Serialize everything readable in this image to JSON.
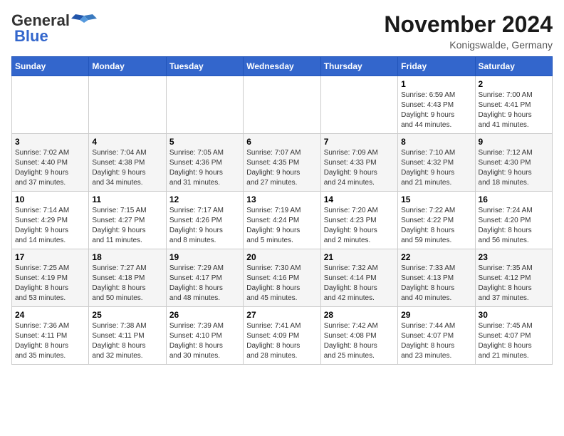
{
  "header": {
    "logo_general": "General",
    "logo_blue": "Blue",
    "month_title": "November 2024",
    "location": "Konigswalde, Germany"
  },
  "weekdays": [
    "Sunday",
    "Monday",
    "Tuesday",
    "Wednesday",
    "Thursday",
    "Friday",
    "Saturday"
  ],
  "weeks": [
    [
      {
        "day": "",
        "info": ""
      },
      {
        "day": "",
        "info": ""
      },
      {
        "day": "",
        "info": ""
      },
      {
        "day": "",
        "info": ""
      },
      {
        "day": "",
        "info": ""
      },
      {
        "day": "1",
        "info": "Sunrise: 6:59 AM\nSunset: 4:43 PM\nDaylight: 9 hours\nand 44 minutes."
      },
      {
        "day": "2",
        "info": "Sunrise: 7:00 AM\nSunset: 4:41 PM\nDaylight: 9 hours\nand 41 minutes."
      }
    ],
    [
      {
        "day": "3",
        "info": "Sunrise: 7:02 AM\nSunset: 4:40 PM\nDaylight: 9 hours\nand 37 minutes."
      },
      {
        "day": "4",
        "info": "Sunrise: 7:04 AM\nSunset: 4:38 PM\nDaylight: 9 hours\nand 34 minutes."
      },
      {
        "day": "5",
        "info": "Sunrise: 7:05 AM\nSunset: 4:36 PM\nDaylight: 9 hours\nand 31 minutes."
      },
      {
        "day": "6",
        "info": "Sunrise: 7:07 AM\nSunset: 4:35 PM\nDaylight: 9 hours\nand 27 minutes."
      },
      {
        "day": "7",
        "info": "Sunrise: 7:09 AM\nSunset: 4:33 PM\nDaylight: 9 hours\nand 24 minutes."
      },
      {
        "day": "8",
        "info": "Sunrise: 7:10 AM\nSunset: 4:32 PM\nDaylight: 9 hours\nand 21 minutes."
      },
      {
        "day": "9",
        "info": "Sunrise: 7:12 AM\nSunset: 4:30 PM\nDaylight: 9 hours\nand 18 minutes."
      }
    ],
    [
      {
        "day": "10",
        "info": "Sunrise: 7:14 AM\nSunset: 4:29 PM\nDaylight: 9 hours\nand 14 minutes."
      },
      {
        "day": "11",
        "info": "Sunrise: 7:15 AM\nSunset: 4:27 PM\nDaylight: 9 hours\nand 11 minutes."
      },
      {
        "day": "12",
        "info": "Sunrise: 7:17 AM\nSunset: 4:26 PM\nDaylight: 9 hours\nand 8 minutes."
      },
      {
        "day": "13",
        "info": "Sunrise: 7:19 AM\nSunset: 4:24 PM\nDaylight: 9 hours\nand 5 minutes."
      },
      {
        "day": "14",
        "info": "Sunrise: 7:20 AM\nSunset: 4:23 PM\nDaylight: 9 hours\nand 2 minutes."
      },
      {
        "day": "15",
        "info": "Sunrise: 7:22 AM\nSunset: 4:22 PM\nDaylight: 8 hours\nand 59 minutes."
      },
      {
        "day": "16",
        "info": "Sunrise: 7:24 AM\nSunset: 4:20 PM\nDaylight: 8 hours\nand 56 minutes."
      }
    ],
    [
      {
        "day": "17",
        "info": "Sunrise: 7:25 AM\nSunset: 4:19 PM\nDaylight: 8 hours\nand 53 minutes."
      },
      {
        "day": "18",
        "info": "Sunrise: 7:27 AM\nSunset: 4:18 PM\nDaylight: 8 hours\nand 50 minutes."
      },
      {
        "day": "19",
        "info": "Sunrise: 7:29 AM\nSunset: 4:17 PM\nDaylight: 8 hours\nand 48 minutes."
      },
      {
        "day": "20",
        "info": "Sunrise: 7:30 AM\nSunset: 4:16 PM\nDaylight: 8 hours\nand 45 minutes."
      },
      {
        "day": "21",
        "info": "Sunrise: 7:32 AM\nSunset: 4:14 PM\nDaylight: 8 hours\nand 42 minutes."
      },
      {
        "day": "22",
        "info": "Sunrise: 7:33 AM\nSunset: 4:13 PM\nDaylight: 8 hours\nand 40 minutes."
      },
      {
        "day": "23",
        "info": "Sunrise: 7:35 AM\nSunset: 4:12 PM\nDaylight: 8 hours\nand 37 minutes."
      }
    ],
    [
      {
        "day": "24",
        "info": "Sunrise: 7:36 AM\nSunset: 4:11 PM\nDaylight: 8 hours\nand 35 minutes."
      },
      {
        "day": "25",
        "info": "Sunrise: 7:38 AM\nSunset: 4:11 PM\nDaylight: 8 hours\nand 32 minutes."
      },
      {
        "day": "26",
        "info": "Sunrise: 7:39 AM\nSunset: 4:10 PM\nDaylight: 8 hours\nand 30 minutes."
      },
      {
        "day": "27",
        "info": "Sunrise: 7:41 AM\nSunset: 4:09 PM\nDaylight: 8 hours\nand 28 minutes."
      },
      {
        "day": "28",
        "info": "Sunrise: 7:42 AM\nSunset: 4:08 PM\nDaylight: 8 hours\nand 25 minutes."
      },
      {
        "day": "29",
        "info": "Sunrise: 7:44 AM\nSunset: 4:07 PM\nDaylight: 8 hours\nand 23 minutes."
      },
      {
        "day": "30",
        "info": "Sunrise: 7:45 AM\nSunset: 4:07 PM\nDaylight: 8 hours\nand 21 minutes."
      }
    ]
  ]
}
